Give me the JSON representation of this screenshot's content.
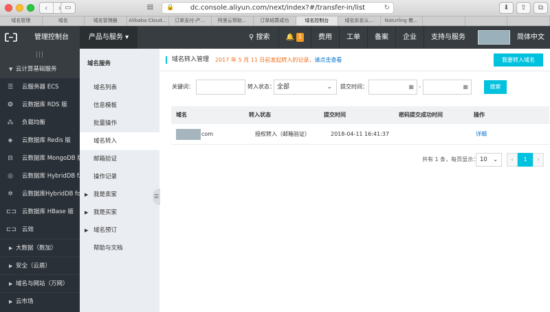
{
  "browser": {
    "url": "dc.console.aliyun.com/next/index?#/transfer-in/list",
    "tabs": [
      {
        "label": "域名管理"
      },
      {
        "label": "域名"
      },
      {
        "label": "域名管理器"
      },
      {
        "label": "Alibaba Cloud..."
      },
      {
        "label": "订单支付-产..."
      },
      {
        "label": "阿里云帮助..."
      },
      {
        "label": "订单结算成功"
      },
      {
        "label": "域名控制台"
      },
      {
        "label": "域名实名认..."
      },
      {
        "label": "Naturling 教..."
      },
      {
        "label": ""
      },
      {
        "label": ""
      },
      {
        "label": ""
      }
    ]
  },
  "topnav": {
    "console": "管理控制台",
    "products": "产品与服务",
    "search": "搜索",
    "bell_count": "1",
    "items": [
      "费用",
      "工单",
      "备案",
      "企业",
      "支持与服务"
    ],
    "language": "简体中文"
  },
  "sidebar": {
    "group": "云计算基础服务",
    "items": [
      {
        "label": "云服务器 ECS",
        "icon": "server-icon"
      },
      {
        "label": "云数据库 RDS 版",
        "icon": "database-icon"
      },
      {
        "label": "负载均衡",
        "icon": "load-balancer-icon"
      },
      {
        "label": "云数据库 Redis 版",
        "icon": "redis-icon"
      },
      {
        "label": "云数据库 MongoDB 版",
        "icon": "mongodb-icon"
      },
      {
        "label": "云数据库 HybridDB f...",
        "icon": "hybriddb-icon"
      },
      {
        "label": "云数据库HybridDB fo...",
        "icon": "hybriddb2-icon"
      },
      {
        "label": "云数据库 HBase 版",
        "icon": "hbase-icon"
      },
      {
        "label": "云效",
        "icon": "yunxiao-icon"
      }
    ],
    "subgroups": [
      "大数据（数加）",
      "安全（云盾）",
      "域名与网站（万网）",
      "云市场"
    ]
  },
  "subnav": {
    "title": "域名服务",
    "items": [
      {
        "label": "域名列表",
        "arrow": false
      },
      {
        "label": "信息模板",
        "arrow": false
      },
      {
        "label": "批量操作",
        "arrow": false
      },
      {
        "label": "域名转入",
        "arrow": false,
        "active": true
      },
      {
        "label": "邮箱验证",
        "arrow": false
      },
      {
        "label": "操作记录",
        "arrow": false
      },
      {
        "label": "我是卖家",
        "arrow": true
      },
      {
        "label": "我是买家",
        "arrow": true
      },
      {
        "label": "域名预订",
        "arrow": true
      },
      {
        "label": "帮助与文档",
        "arrow": false
      }
    ]
  },
  "main": {
    "title": "域名转入管理",
    "notice": "2017 年 5 月 11 日前发起转入的记录，",
    "notice_link": "请点击查看",
    "transfer_button": "我要转入域名",
    "filter": {
      "keyword_label": "关键词：",
      "status_label": "转入状态：",
      "status_value": "全部",
      "time_label": "提交时间：",
      "dash": "-",
      "search_button": "搜索"
    },
    "table": {
      "headers": [
        "域名",
        "转入状态",
        "提交时间",
        "密码提交成功时间",
        "操作"
      ],
      "rows": [
        {
          "domain_suffix": "com",
          "status": "授权转入（邮箱验证）",
          "time": "2018-04-11 16:41:37",
          "pwd_time": "",
          "action": "详细"
        }
      ]
    },
    "pager": {
      "summary": "共有 1 条，每页显示：",
      "page_size": "10",
      "prev": "‹",
      "current": "1",
      "next": "›"
    }
  },
  "colors": {
    "accent": "#00c1de",
    "topnav": "#373d41",
    "sidebar": "#293038",
    "notice": "#f06e1e",
    "link": "#0070cc"
  }
}
